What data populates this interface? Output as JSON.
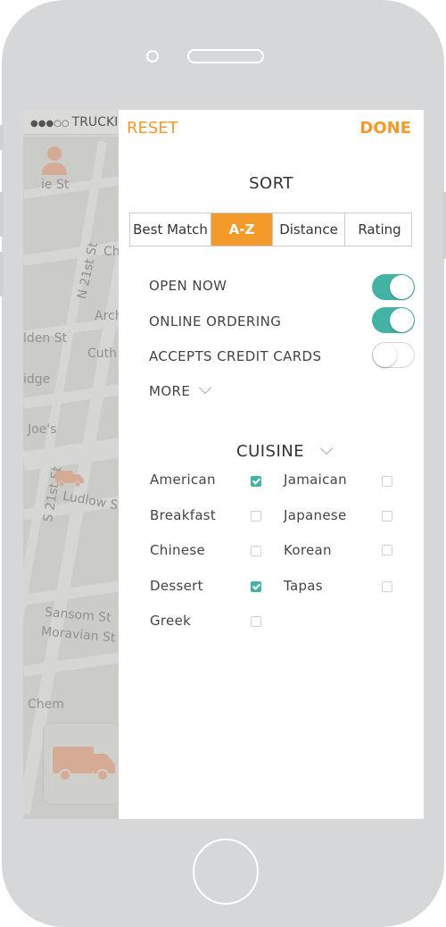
{
  "status_bar": {
    "dots": "●●●○○",
    "carrier": "TRUCKI"
  },
  "map": {
    "labels": [
      "Sansom St",
      "Moravian St",
      "Arch",
      "Cuth",
      "Ludlow S",
      "N 21st St",
      "S 21st St",
      "Joe's",
      "lden St",
      "idge",
      "Chem",
      "Ch",
      "ie St"
    ]
  },
  "header": {
    "reset_label": "RESET",
    "done_label": "DONE"
  },
  "sort": {
    "title": "SORT",
    "options": [
      "Best Match",
      "A-Z",
      "Distance",
      "Rating"
    ],
    "selected": "A-Z"
  },
  "filters": [
    {
      "label": "OPEN NOW",
      "on": true
    },
    {
      "label": "ONLINE ORDERING",
      "on": true
    },
    {
      "label": "ACCEPTS CREDIT CARDS",
      "on": false
    }
  ],
  "more_label": "MORE",
  "cuisine": {
    "title": "CUISINE",
    "left": [
      {
        "label": "American",
        "checked": true
      },
      {
        "label": "Breakfast",
        "checked": false
      },
      {
        "label": "Chinese",
        "checked": false
      },
      {
        "label": "Dessert",
        "checked": true
      },
      {
        "label": "Greek",
        "checked": false
      }
    ],
    "right": [
      {
        "label": "Jamaican",
        "checked": false
      },
      {
        "label": "Japanese",
        "checked": false
      },
      {
        "label": "Korean",
        "checked": false
      },
      {
        "label": "Tapas",
        "checked": false
      }
    ]
  },
  "colors": {
    "accent": "#f39a2b",
    "toggle_on": "#45b3a4"
  }
}
